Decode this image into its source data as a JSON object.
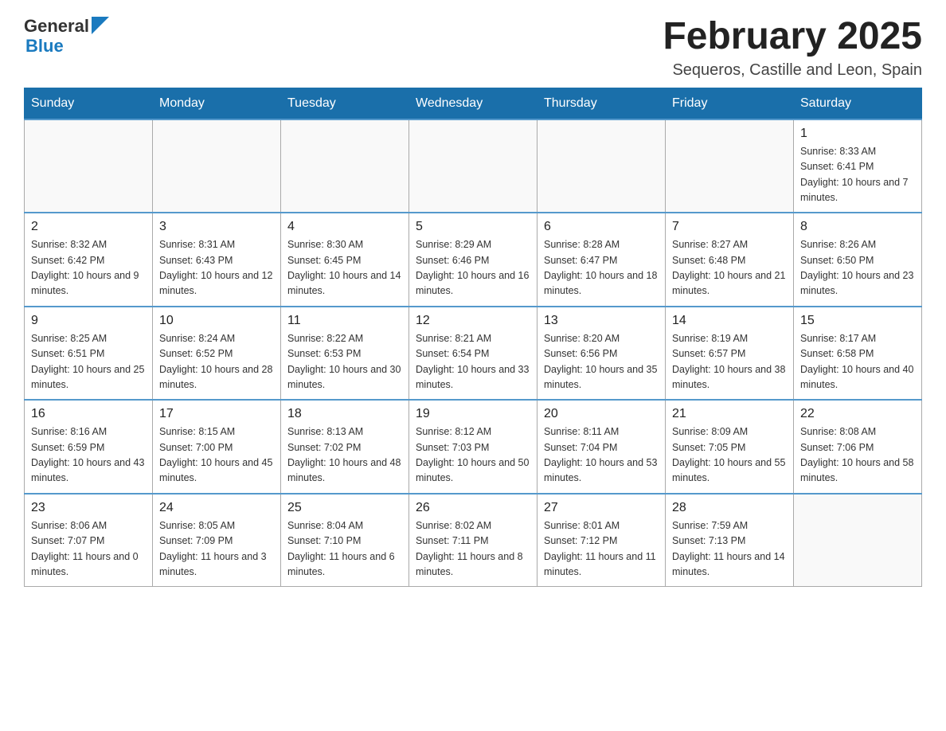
{
  "logo": {
    "text_general": "General",
    "text_blue": "Blue"
  },
  "header": {
    "month_title": "February 2025",
    "location": "Sequeros, Castille and Leon, Spain"
  },
  "days_of_week": [
    "Sunday",
    "Monday",
    "Tuesday",
    "Wednesday",
    "Thursday",
    "Friday",
    "Saturday"
  ],
  "weeks": [
    [
      {
        "day": "",
        "info": ""
      },
      {
        "day": "",
        "info": ""
      },
      {
        "day": "",
        "info": ""
      },
      {
        "day": "",
        "info": ""
      },
      {
        "day": "",
        "info": ""
      },
      {
        "day": "",
        "info": ""
      },
      {
        "day": "1",
        "info": "Sunrise: 8:33 AM\nSunset: 6:41 PM\nDaylight: 10 hours and 7 minutes."
      }
    ],
    [
      {
        "day": "2",
        "info": "Sunrise: 8:32 AM\nSunset: 6:42 PM\nDaylight: 10 hours and 9 minutes."
      },
      {
        "day": "3",
        "info": "Sunrise: 8:31 AM\nSunset: 6:43 PM\nDaylight: 10 hours and 12 minutes."
      },
      {
        "day": "4",
        "info": "Sunrise: 8:30 AM\nSunset: 6:45 PM\nDaylight: 10 hours and 14 minutes."
      },
      {
        "day": "5",
        "info": "Sunrise: 8:29 AM\nSunset: 6:46 PM\nDaylight: 10 hours and 16 minutes."
      },
      {
        "day": "6",
        "info": "Sunrise: 8:28 AM\nSunset: 6:47 PM\nDaylight: 10 hours and 18 minutes."
      },
      {
        "day": "7",
        "info": "Sunrise: 8:27 AM\nSunset: 6:48 PM\nDaylight: 10 hours and 21 minutes."
      },
      {
        "day": "8",
        "info": "Sunrise: 8:26 AM\nSunset: 6:50 PM\nDaylight: 10 hours and 23 minutes."
      }
    ],
    [
      {
        "day": "9",
        "info": "Sunrise: 8:25 AM\nSunset: 6:51 PM\nDaylight: 10 hours and 25 minutes."
      },
      {
        "day": "10",
        "info": "Sunrise: 8:24 AM\nSunset: 6:52 PM\nDaylight: 10 hours and 28 minutes."
      },
      {
        "day": "11",
        "info": "Sunrise: 8:22 AM\nSunset: 6:53 PM\nDaylight: 10 hours and 30 minutes."
      },
      {
        "day": "12",
        "info": "Sunrise: 8:21 AM\nSunset: 6:54 PM\nDaylight: 10 hours and 33 minutes."
      },
      {
        "day": "13",
        "info": "Sunrise: 8:20 AM\nSunset: 6:56 PM\nDaylight: 10 hours and 35 minutes."
      },
      {
        "day": "14",
        "info": "Sunrise: 8:19 AM\nSunset: 6:57 PM\nDaylight: 10 hours and 38 minutes."
      },
      {
        "day": "15",
        "info": "Sunrise: 8:17 AM\nSunset: 6:58 PM\nDaylight: 10 hours and 40 minutes."
      }
    ],
    [
      {
        "day": "16",
        "info": "Sunrise: 8:16 AM\nSunset: 6:59 PM\nDaylight: 10 hours and 43 minutes."
      },
      {
        "day": "17",
        "info": "Sunrise: 8:15 AM\nSunset: 7:00 PM\nDaylight: 10 hours and 45 minutes."
      },
      {
        "day": "18",
        "info": "Sunrise: 8:13 AM\nSunset: 7:02 PM\nDaylight: 10 hours and 48 minutes."
      },
      {
        "day": "19",
        "info": "Sunrise: 8:12 AM\nSunset: 7:03 PM\nDaylight: 10 hours and 50 minutes."
      },
      {
        "day": "20",
        "info": "Sunrise: 8:11 AM\nSunset: 7:04 PM\nDaylight: 10 hours and 53 minutes."
      },
      {
        "day": "21",
        "info": "Sunrise: 8:09 AM\nSunset: 7:05 PM\nDaylight: 10 hours and 55 minutes."
      },
      {
        "day": "22",
        "info": "Sunrise: 8:08 AM\nSunset: 7:06 PM\nDaylight: 10 hours and 58 minutes."
      }
    ],
    [
      {
        "day": "23",
        "info": "Sunrise: 8:06 AM\nSunset: 7:07 PM\nDaylight: 11 hours and 0 minutes."
      },
      {
        "day": "24",
        "info": "Sunrise: 8:05 AM\nSunset: 7:09 PM\nDaylight: 11 hours and 3 minutes."
      },
      {
        "day": "25",
        "info": "Sunrise: 8:04 AM\nSunset: 7:10 PM\nDaylight: 11 hours and 6 minutes."
      },
      {
        "day": "26",
        "info": "Sunrise: 8:02 AM\nSunset: 7:11 PM\nDaylight: 11 hours and 8 minutes."
      },
      {
        "day": "27",
        "info": "Sunrise: 8:01 AM\nSunset: 7:12 PM\nDaylight: 11 hours and 11 minutes."
      },
      {
        "day": "28",
        "info": "Sunrise: 7:59 AM\nSunset: 7:13 PM\nDaylight: 11 hours and 14 minutes."
      },
      {
        "day": "",
        "info": ""
      }
    ]
  ]
}
